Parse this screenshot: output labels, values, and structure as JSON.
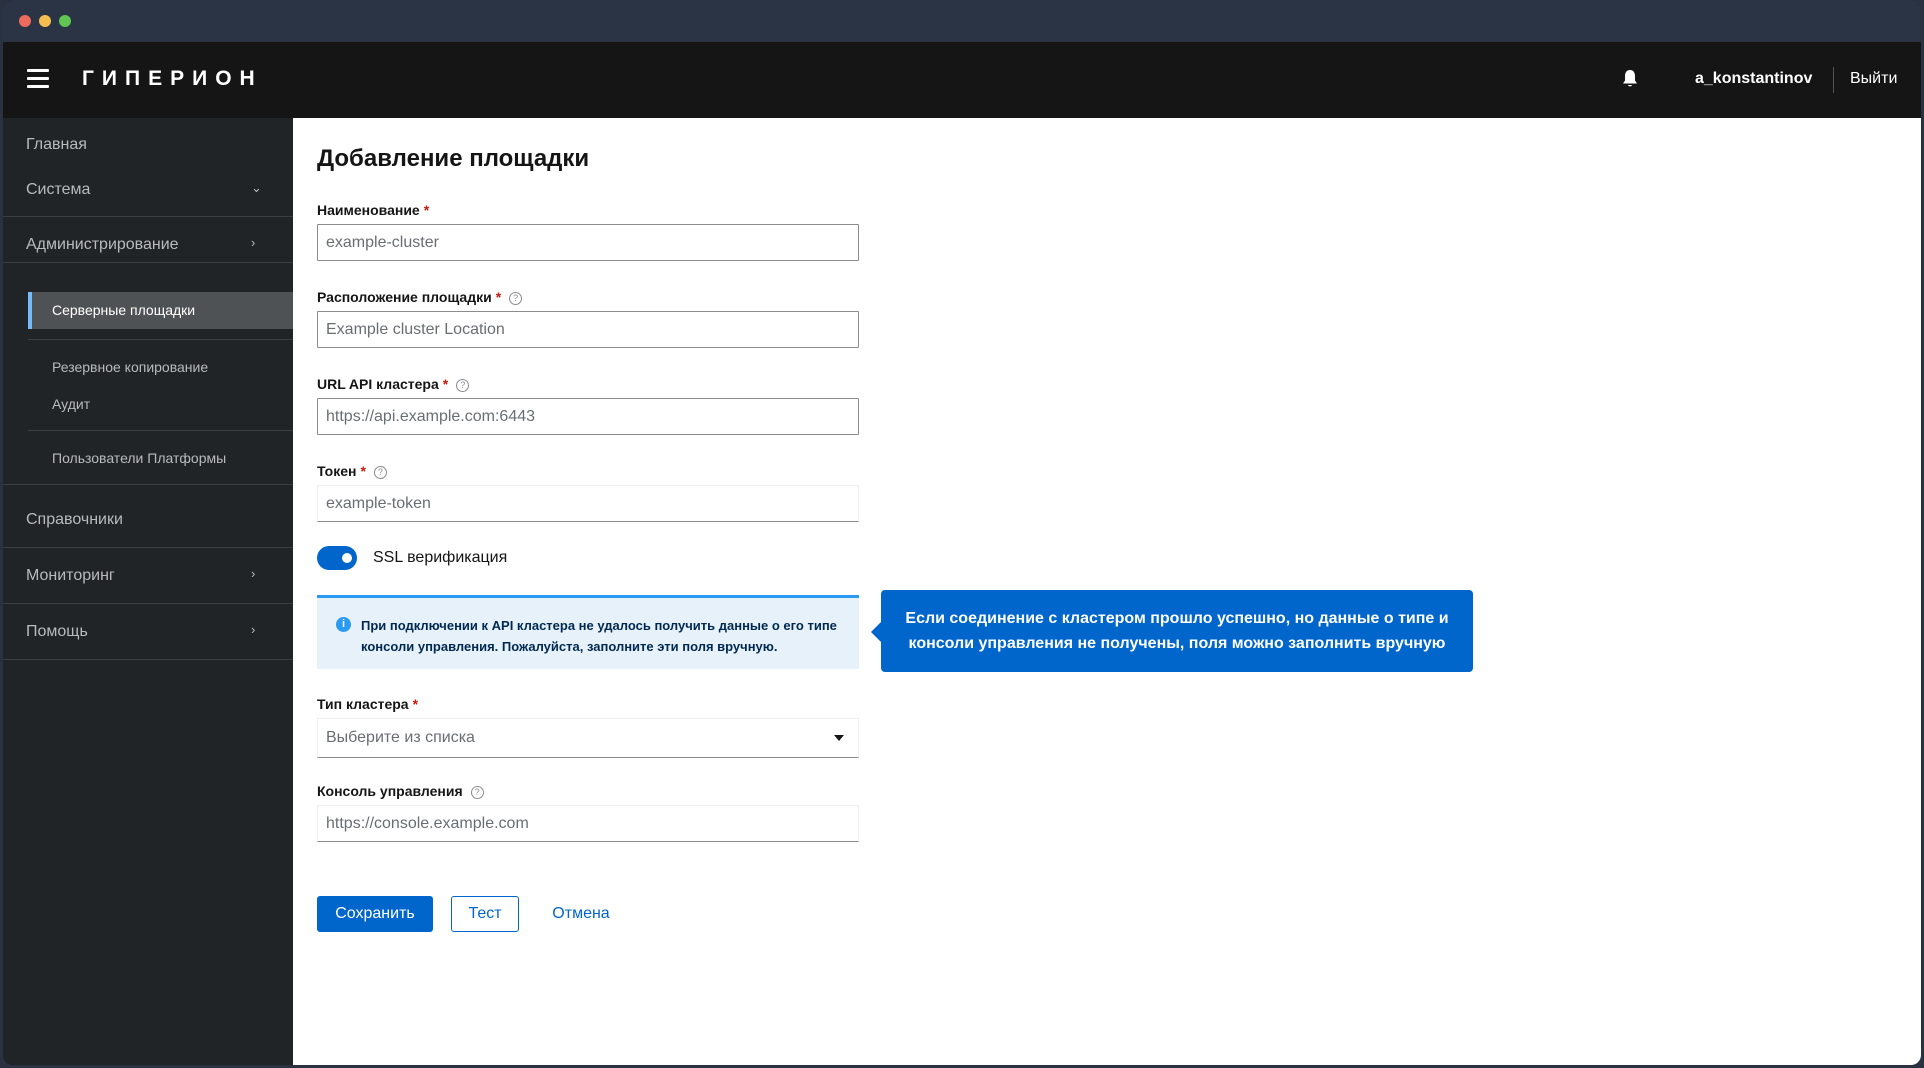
{
  "masthead": {
    "brand": "ГИПЕРИОН",
    "username": "a_konstantinov",
    "logout_label": "Выйти"
  },
  "sidebar": {
    "items": [
      {
        "label": "Главная"
      },
      {
        "label": "Система",
        "chevron": "⌄"
      },
      {
        "label": "Администрирование",
        "chevron": "›"
      },
      {
        "label": "Справочники"
      },
      {
        "label": "Мониторинг",
        "chevron": "›"
      },
      {
        "label": "Помощь",
        "chevron": "›"
      }
    ],
    "sub_items": [
      {
        "label": "Серверные площадки",
        "active": true
      },
      {
        "label": "Резервное копирование"
      },
      {
        "label": "Аудит"
      },
      {
        "label": "Пользователи Платформы"
      }
    ]
  },
  "form": {
    "title": "Добавление площадки",
    "required_mark": "*",
    "help_glyph": "?",
    "name": {
      "label": "Наименование",
      "placeholder": "example-cluster"
    },
    "location": {
      "label": "Расположение площадки",
      "placeholder": "Example cluster Location"
    },
    "url": {
      "label": "URL API кластера",
      "placeholder": "https://api.example.com:6443"
    },
    "token": {
      "label": "Токен",
      "placeholder": "example-token"
    },
    "ssl": {
      "label": "SSL верификация",
      "enabled": true
    },
    "alert": {
      "icon": "info-icon",
      "text": "При подключении к API кластера не удалось получить данные о его типе консоли управления. Пожалуйста, заполните эти поля вручную."
    },
    "cluster_type": {
      "label": "Тип кластера",
      "value": "Выберите из списка"
    },
    "console": {
      "label": "Консоль управления",
      "placeholder": "https://console.example.com"
    },
    "save_label": "Сохранить",
    "test_label": "Тест",
    "cancel_label": "Отмена"
  },
  "callout": {
    "text": "Если соединение с кластером прошло успешно, но данные о типе и консоли управления не получены, поля можно заполнить вручную"
  },
  "colors": {
    "accent": "#0066cc",
    "alert_bg": "#e7f1fa",
    "sidebar_bg": "#212427",
    "masthead_bg": "#151515"
  }
}
